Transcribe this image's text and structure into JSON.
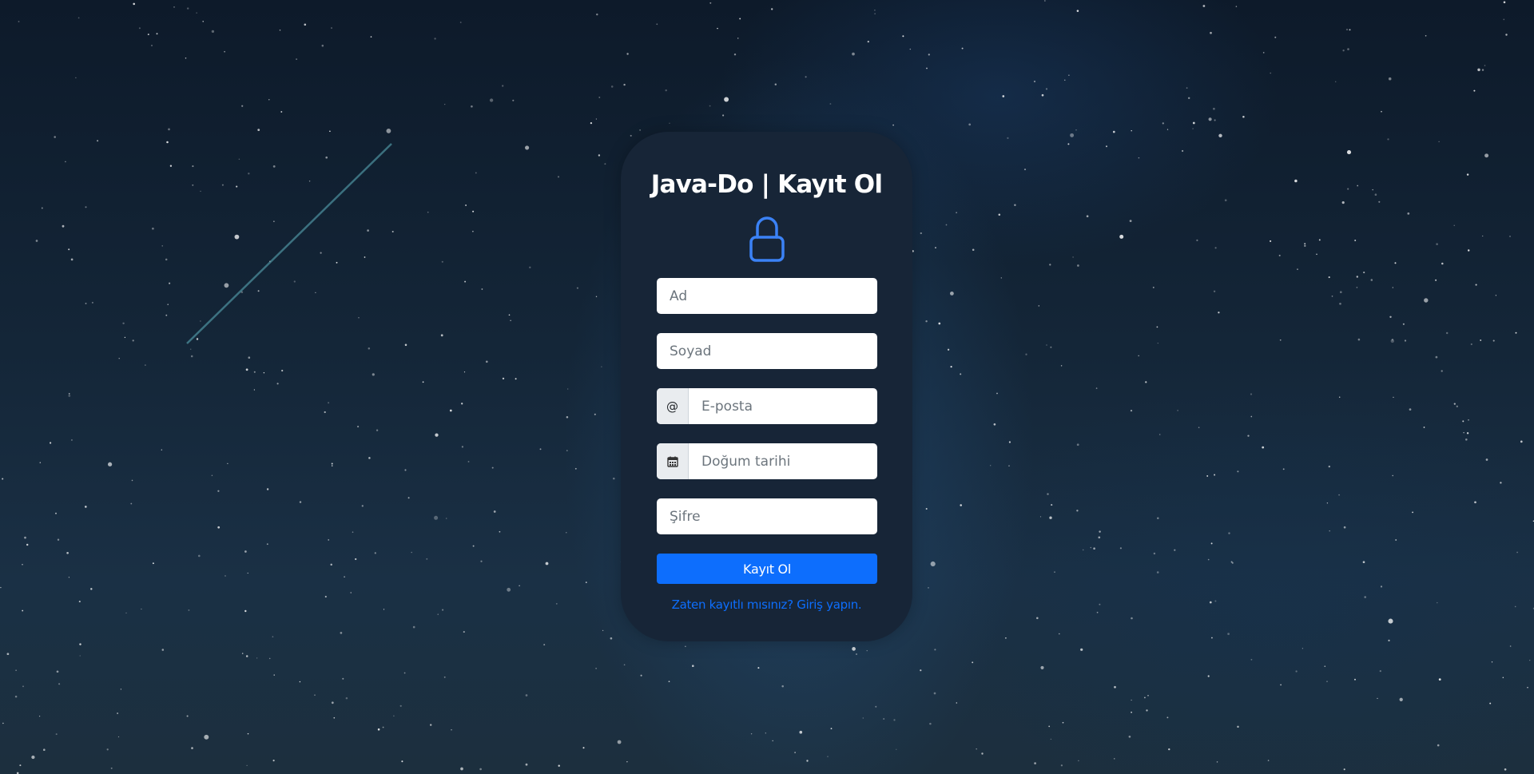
{
  "page": {
    "background": "starry-night-sky"
  },
  "form": {
    "title": "Java-Do | Kayıt Ol",
    "icon": "lock-icon",
    "first_name": {
      "placeholder": "Ad",
      "value": ""
    },
    "last_name": {
      "placeholder": "Soyad",
      "value": ""
    },
    "email": {
      "addon": "@",
      "placeholder": "E-posta",
      "value": ""
    },
    "birth_date": {
      "addon_icon": "calendar-icon",
      "placeholder": "Doğum tarihi",
      "value": ""
    },
    "password": {
      "placeholder": "Şifre",
      "value": ""
    },
    "submit_label": "Kayıt Ol",
    "login_link": "Zaten kayıtlı mısınız? Giriş yapın."
  },
  "colors": {
    "card_bg": "#172537",
    "accent": "#0d6efd",
    "lock_stroke": "#3b82f6",
    "title_text": "#ffffff"
  }
}
